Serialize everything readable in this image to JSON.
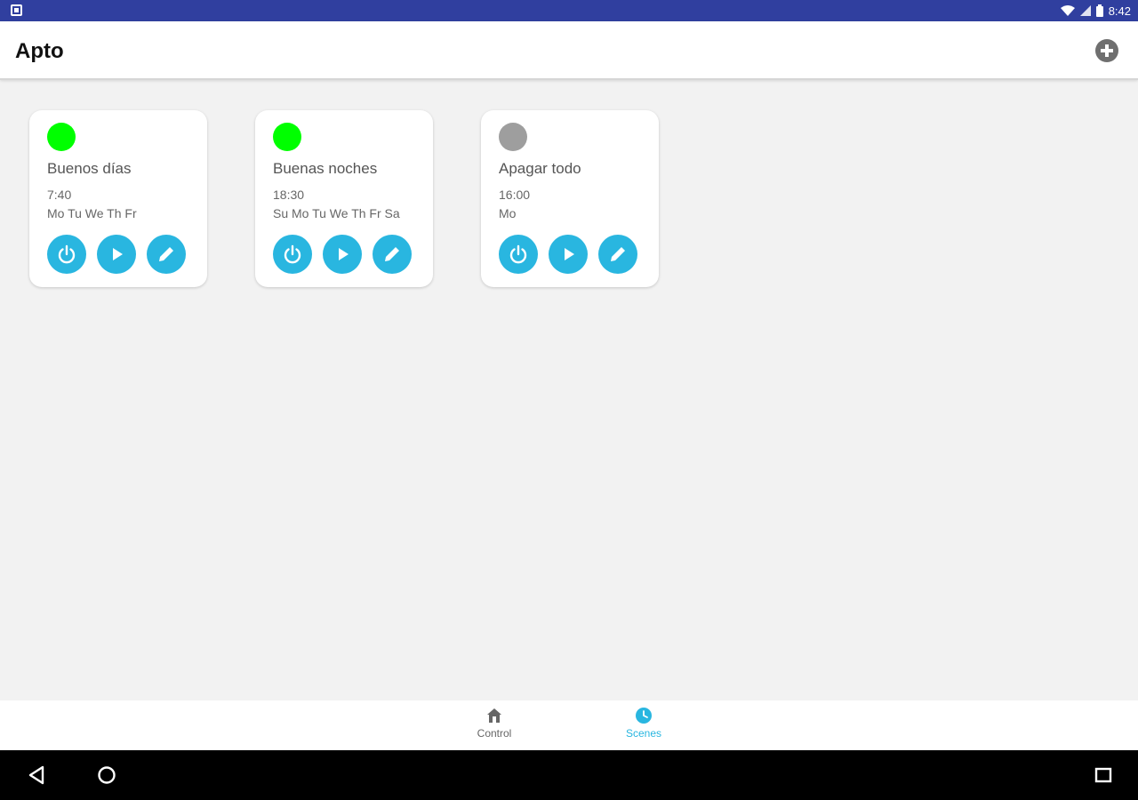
{
  "status": {
    "time": "8:42"
  },
  "app": {
    "title": "Apto"
  },
  "scenes": [
    {
      "name": "Buenos días",
      "time": "7:40",
      "days": "Mo Tu We Th Fr",
      "active": true,
      "status_color": "#00ff00"
    },
    {
      "name": "Buenas noches",
      "time": "18:30",
      "days": "Su Mo Tu We Th Fr Sa",
      "active": true,
      "status_color": "#00ff00"
    },
    {
      "name": "Apagar todo",
      "time": "16:00",
      "days": "Mo",
      "active": false,
      "status_color": "#9e9e9e"
    }
  ],
  "nav": {
    "control_label": "Control",
    "scenes_label": "Scenes",
    "active_tab": "scenes"
  },
  "colors": {
    "accent": "#29b6e0",
    "status_bar": "#303f9f",
    "active_status": "#00ff00",
    "inactive_status": "#9e9e9e",
    "inactive_nav": "#666666"
  },
  "icons": {
    "card_actions": [
      "power-icon",
      "play-icon",
      "edit-icon"
    ],
    "app_bar": "add-circle-icon",
    "nav": [
      "home-icon",
      "clock-icon"
    ],
    "system_nav": [
      "back-icon",
      "home-circle-icon",
      "recents-icon"
    ]
  }
}
